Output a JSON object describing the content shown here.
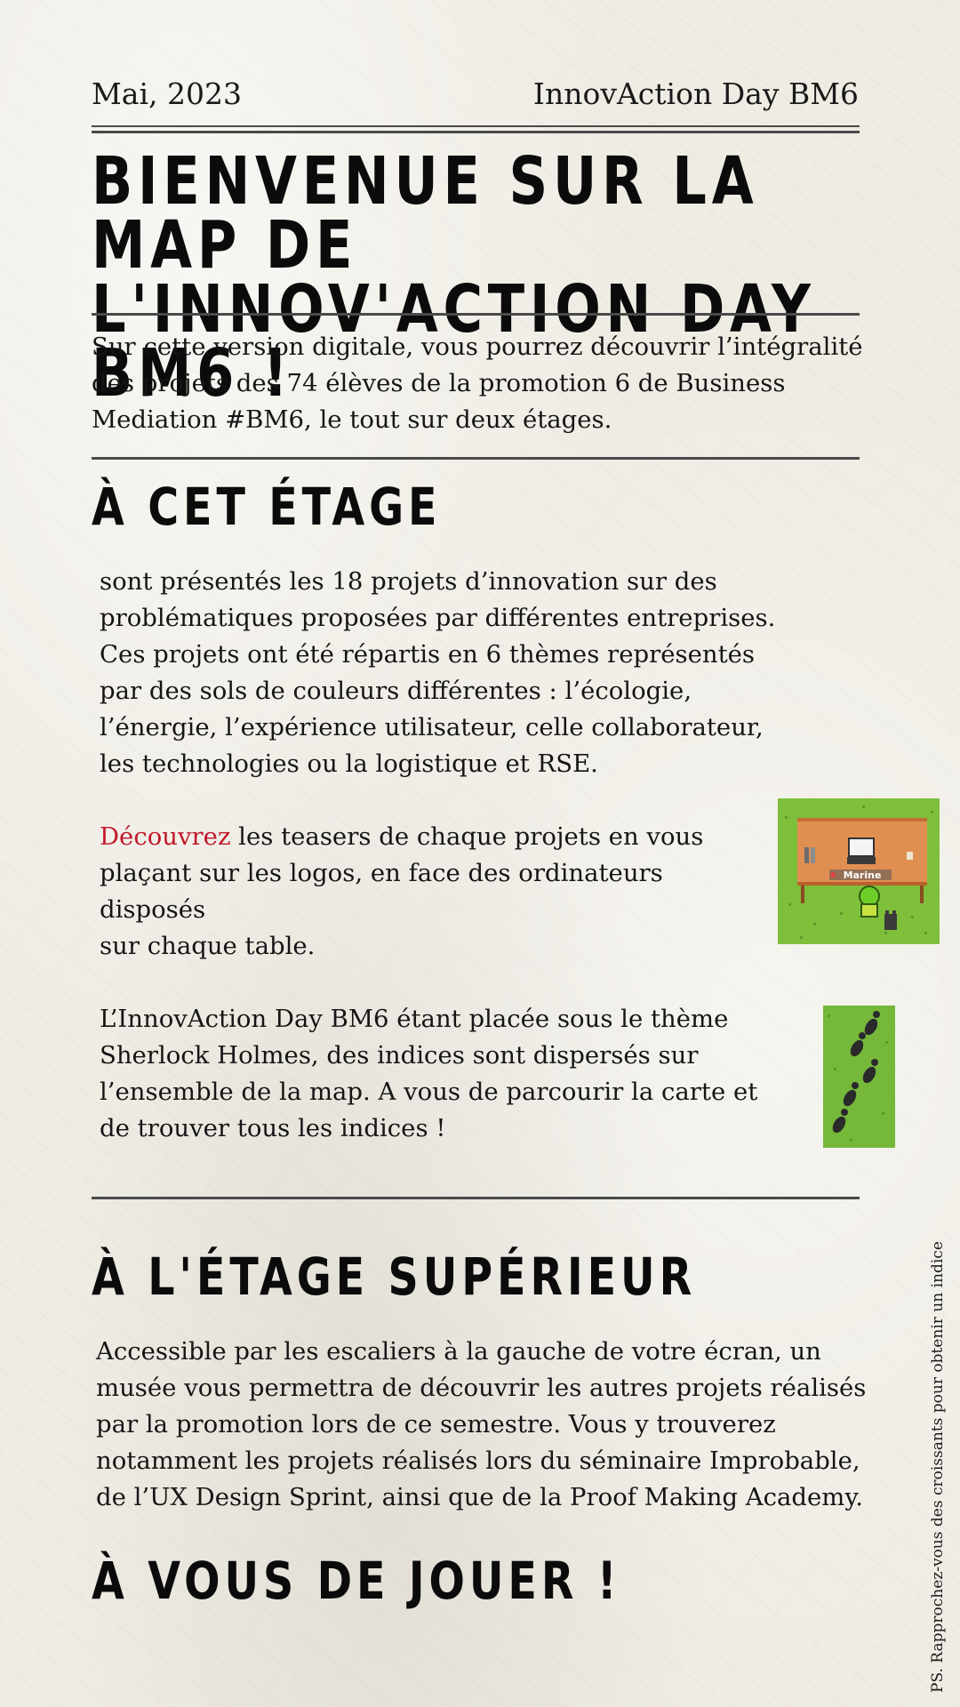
{
  "header": {
    "date": "Mai, 2023",
    "event": "InnovAction Day BM6"
  },
  "title": {
    "line1": "BIENVENUE SUR LA MAP DE",
    "line2": "L'INNOV'ACTION DAY BM6 !"
  },
  "intro": {
    "line1": "Sur cette version digitale, vous pourrez découvrir l’intégralité",
    "line2": "des projets des 74 élèves de la promotion 6 de Business",
    "line3": "Mediation #BM6, le tout sur deux étages."
  },
  "section_floor": {
    "title": "À CET ÉTAGE",
    "para1": {
      "line1": "sont présentés les 18 projets d’innovation sur des",
      "line2": "problématiques proposées par différentes entreprises.",
      "line3": "Ces projets ont été répartis en 6 thèmes représentés",
      "line4": "par des sols de couleurs différentes :  l’écologie,",
      "line5": "l’énergie, l’expérience utilisateur, celle collaborateur,",
      "line6": "les technologies ou la logistique et RSE."
    },
    "para2": {
      "accent_word": "Découvrez",
      "line1_rest": " les teasers de chaque projets en vous",
      "line2": "plaçant sur les logos, en face des ordinateurs disposés",
      "line3": "sur chaque table."
    },
    "para3": {
      "line1": "L’InnovAction Day BM6 étant placée sous le thème",
      "line2": "Sherlock Holmes, des indices sont dispersés sur",
      "line3": "l’ensemble de la map. A vous de parcourir la carte et",
      "line4": "de trouver tous les indices !"
    },
    "thumbnail_label": "Marine"
  },
  "section_upper": {
    "title": "À L'ÉTAGE SUPÉRIEUR",
    "line1": "Accessible par les escaliers à la gauche de votre écran, un",
    "line2": "musée vous permettra de découvrir les autres projets réalisés",
    "line3": "par la promotion lors de ce semestre. Vous y trouverez",
    "line4": "notamment les projets réalisés lors du séminaire Improbable,",
    "line5": "de l’UX Design Sprint, ainsi que de la Proof Making Academy."
  },
  "closing": {
    "title": "À VOUS DE JOUER !"
  },
  "side_note": "PS. Rapprochez-vous des croissants pour obtenir un indice",
  "colors": {
    "accent": "#c0182b",
    "paper": "#efece4",
    "grass": "#7ebf3c"
  }
}
